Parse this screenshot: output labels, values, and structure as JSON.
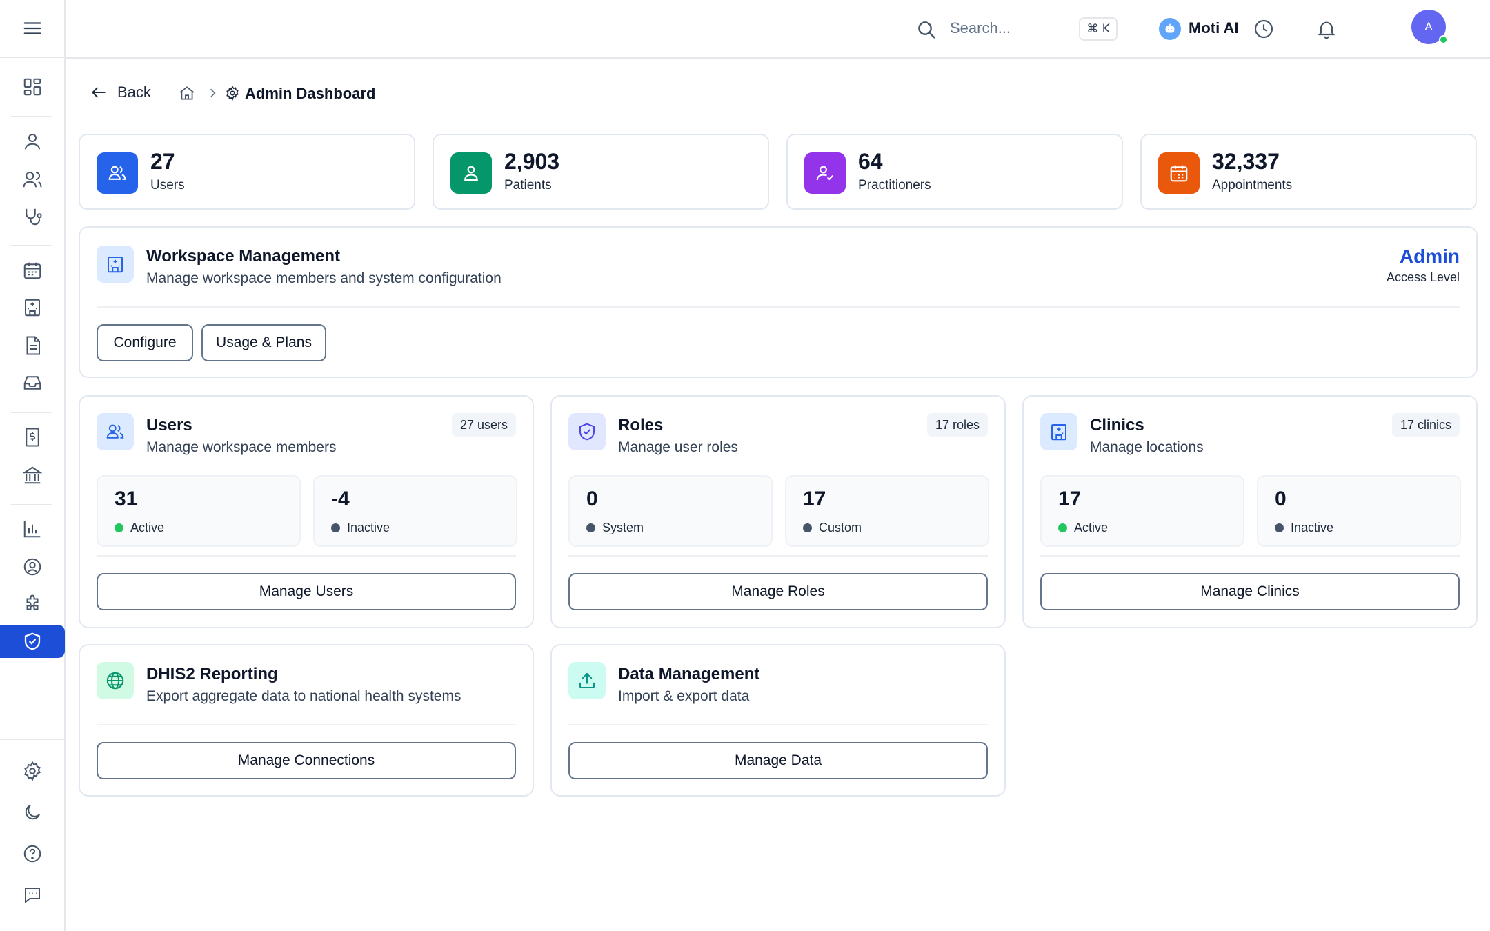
{
  "header": {
    "search_placeholder": "Search...",
    "shortcut": "⌘ K",
    "assistant_label": "Moti AI",
    "avatar_initial": "A"
  },
  "breadcrumb": {
    "back_label": "Back",
    "page_title": "Admin Dashboard"
  },
  "stats": [
    {
      "value": "27",
      "label": "Users",
      "color": "#2563eb"
    },
    {
      "value": "2,903",
      "label": "Patients",
      "color": "#059669"
    },
    {
      "value": "64",
      "label": "Practitioners",
      "color": "#9333ea"
    },
    {
      "value": "32,337",
      "label": "Appointments",
      "color": "#ea580c"
    }
  ],
  "workspace": {
    "title": "Workspace Management",
    "subtitle": "Manage workspace members and system configuration",
    "access_level": "Admin",
    "access_level_label": "Access Level",
    "configure_label": "Configure",
    "usage_label": "Usage & Plans"
  },
  "modules": {
    "users": {
      "title": "Users",
      "subtitle": "Manage workspace members",
      "badge": "27 users",
      "stat1_value": "31",
      "stat1_label": "Active",
      "stat2_value": "-4",
      "stat2_label": "Inactive",
      "button": "Manage Users"
    },
    "roles": {
      "title": "Roles",
      "subtitle": "Manage user roles",
      "badge": "17 roles",
      "stat1_value": "0",
      "stat1_label": "System",
      "stat2_value": "17",
      "stat2_label": "Custom",
      "button": "Manage Roles"
    },
    "clinics": {
      "title": "Clinics",
      "subtitle": "Manage locations",
      "badge": "17 clinics",
      "stat1_value": "17",
      "stat1_label": "Active",
      "stat2_value": "0",
      "stat2_label": "Inactive",
      "button": "Manage Clinics"
    },
    "dhis2": {
      "title": "DHIS2 Reporting",
      "subtitle": "Export aggregate data to national health systems",
      "button": "Manage Connections"
    },
    "data": {
      "title": "Data Management",
      "subtitle": "Import & export data",
      "button": "Manage Data"
    }
  },
  "colors": {
    "accent": "#1d4ed8",
    "active_dot": "#22c55e",
    "inactive_dot": "#475569"
  }
}
